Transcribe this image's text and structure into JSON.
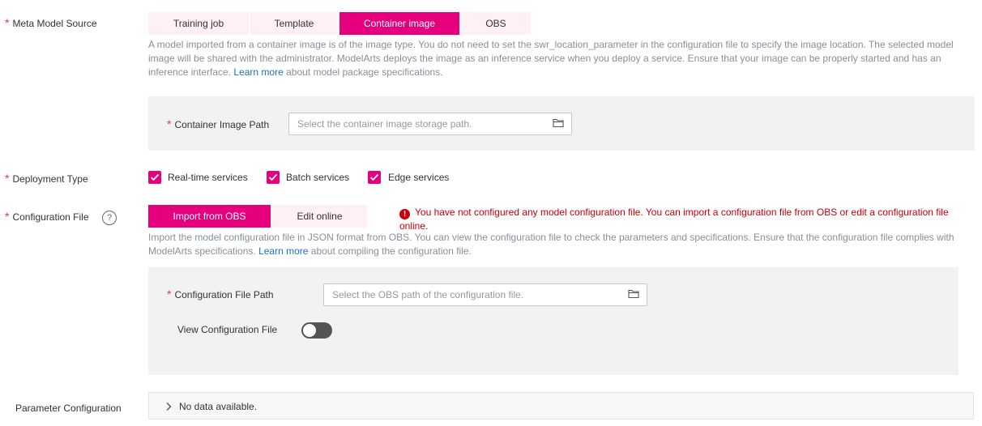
{
  "meta_model_source": {
    "label": "Meta Model Source",
    "tabs": [
      "Training job",
      "Template",
      "Container image",
      "OBS"
    ],
    "active_tab": "Container image",
    "description_1": "A model imported from a container image is of the image type. You do not need to set the swr_location_parameter in the configuration file to specify the image location. The selected model image will be shared with the administrator. ModelArts deploys the image as an inference service when you deploy a service. Ensure that your image can be properly started and has an inference interface. ",
    "learn_more": "Learn more",
    "description_2": " about model package specifications.",
    "container_image_path": {
      "label": "Container Image Path",
      "placeholder": "Select the container image storage path.",
      "value": ""
    }
  },
  "deployment_type": {
    "label": "Deployment Type",
    "options": [
      {
        "label": "Real-time services",
        "checked": true
      },
      {
        "label": "Batch services",
        "checked": true
      },
      {
        "label": "Edge services",
        "checked": true
      }
    ]
  },
  "configuration_file": {
    "label": "Configuration File",
    "help_icon": "?",
    "tabs": [
      "Import from OBS",
      "Edit online"
    ],
    "active_tab": "Import from OBS",
    "error_line_1": "You have not configured any model configuration file. You can import a configuration file from OBS or edit a configuration file",
    "error_line_2": "online.",
    "description_1": "Import the model configuration file in JSON format from OBS. You can view the configuration file to check the parameters and specifications. Ensure that the configuration file complies with ModelArts specifications. ",
    "learn_more": "Learn more",
    "description_2": " about compiling the configuration file.",
    "path": {
      "label": "Configuration File Path",
      "placeholder": "Select the OBS path of the configuration file.",
      "value": ""
    },
    "view_toggle": {
      "label": "View Configuration File",
      "on": false
    }
  },
  "parameter_configuration": {
    "label": "Parameter Configuration",
    "empty_text": "No data available."
  },
  "colors": {
    "accent": "#e6007e",
    "required": "#e0355e",
    "error": "#c7000b",
    "link": "#1f6fbf"
  }
}
